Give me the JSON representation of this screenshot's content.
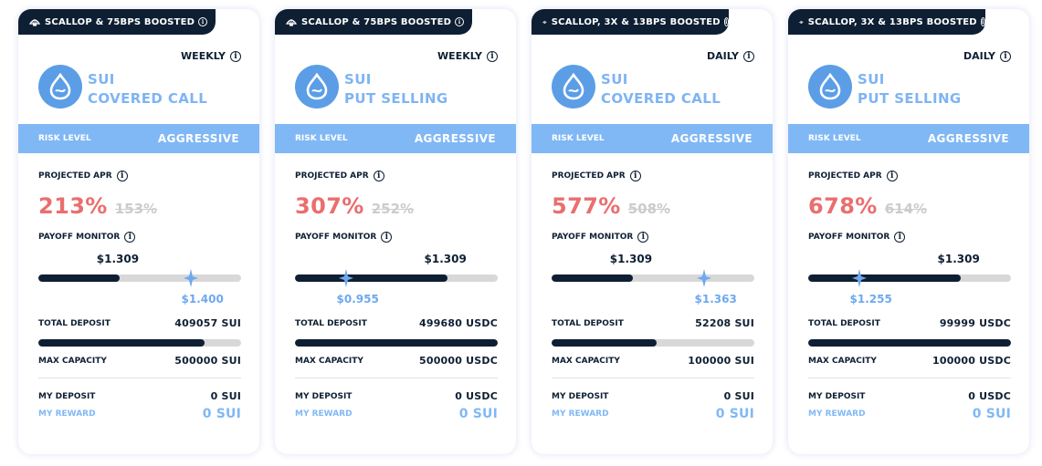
{
  "labels": {
    "risk_level": "RISK LEVEL",
    "projected_apr": "PROJECTED APR",
    "payoff_monitor": "PAYOFF MONITOR",
    "total_deposit": "TOTAL DEPOSIT",
    "max_capacity": "MAX CAPACITY",
    "my_deposit": "MY DEPOSIT",
    "my_reward": "MY REWARD"
  },
  "colors": {
    "navy": "#0e1f33",
    "light_blue": "#80b8f5",
    "coin_blue": "#5c9ee6",
    "apr_red": "#ea6e6e"
  },
  "vaults": [
    {
      "tag": "SCALLOP & 75BPS BOOSTED",
      "frequency": "WEEKLY",
      "asset": "SUI",
      "strategy": "COVERED CALL",
      "risk": "AGGRESSIVE",
      "apr": "213%",
      "apr_old": "153%",
      "current_price": "$1.309",
      "strike_price": "$1.400",
      "payoff_fill_fraction": 0.4,
      "strike_marker_fraction": 0.75,
      "total_deposit": "409057 SUI",
      "deposit_fill_fraction": 0.82,
      "max_capacity": "500000 SUI",
      "my_deposit": "0  SUI",
      "my_reward": "0  SUI"
    },
    {
      "tag": "SCALLOP & 75BPS BOOSTED",
      "frequency": "WEEKLY",
      "asset": "SUI",
      "strategy": "PUT SELLING",
      "risk": "AGGRESSIVE",
      "apr": "307%",
      "apr_old": "252%",
      "current_price": "$1.309",
      "strike_price": "$0.955",
      "payoff_fill_fraction": 0.75,
      "strike_marker_fraction": 0.25,
      "total_deposit": "499680 USDC",
      "deposit_fill_fraction": 1.0,
      "max_capacity": "500000 USDC",
      "my_deposit": "0  USDC",
      "my_reward": "0  SUI"
    },
    {
      "tag": "SCALLOP, 3X & 13BPS BOOSTED",
      "frequency": "DAILY",
      "asset": "SUI",
      "strategy": "COVERED CALL",
      "risk": "AGGRESSIVE",
      "apr": "577%",
      "apr_old": "508%",
      "current_price": "$1.309",
      "strike_price": "$1.363",
      "payoff_fill_fraction": 0.4,
      "strike_marker_fraction": 0.75,
      "total_deposit": "52208 SUI",
      "deposit_fill_fraction": 0.52,
      "max_capacity": "100000 SUI",
      "my_deposit": "0  SUI",
      "my_reward": "0  SUI"
    },
    {
      "tag": "SCALLOP, 3X & 13BPS BOOSTED",
      "frequency": "DAILY",
      "asset": "SUI",
      "strategy": "PUT SELLING",
      "risk": "AGGRESSIVE",
      "apr": "678%",
      "apr_old": "614%",
      "current_price": "$1.309",
      "strike_price": "$1.255",
      "payoff_fill_fraction": 0.75,
      "strike_marker_fraction": 0.25,
      "total_deposit": "99999 USDC",
      "deposit_fill_fraction": 1.0,
      "max_capacity": "100000 USDC",
      "my_deposit": "0  USDC",
      "my_reward": "0  SUI"
    }
  ]
}
